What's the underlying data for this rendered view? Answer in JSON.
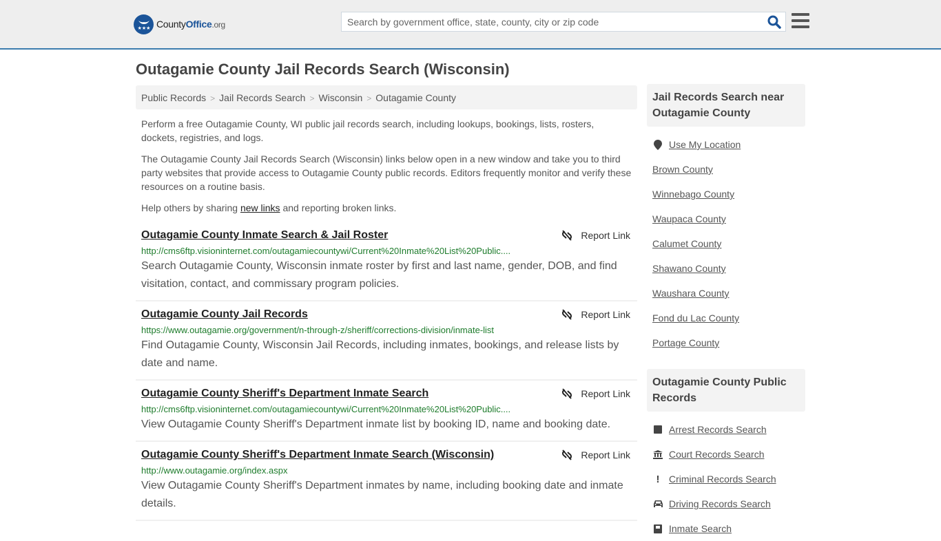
{
  "header": {
    "logo": {
      "brand_prefix": "County",
      "brand_highlight": "Office",
      "brand_suffix": ".org"
    },
    "search": {
      "placeholder": "Search by government office, state, county, city or zip code",
      "value": ""
    },
    "search_icon": "search-icon",
    "menu_icon": "hamburger-menu-icon",
    "colors": {
      "accent": "#3b7cad",
      "brand": "#1b5499"
    }
  },
  "page": {
    "title": "Outagamie County Jail Records Search (Wisconsin)"
  },
  "breadcrumb": [
    "Public Records",
    "Jail Records Search",
    "Wisconsin",
    "Outagamie County"
  ],
  "intro": {
    "p1": "Perform a free Outagamie County, WI public jail records search, including lookups, bookings, lists, rosters, dockets, registries, and logs.",
    "p2": "The Outagamie County Jail Records Search (Wisconsin) links below open in a new window and take you to third party websites that provide access to Outagamie County public records. Editors frequently monitor and verify these resources on a routine basis.",
    "p3_before": "Help others by sharing ",
    "p3_link": "new links",
    "p3_after": " and reporting broken links."
  },
  "results": [
    {
      "title": "Outagamie County Inmate Search & Jail Roster",
      "url": "http://cms6ftp.visioninternet.com/outagamiecountywi/Current%20Inmate%20List%20Public....",
      "description": "Search Outagamie County, Wisconsin inmate roster by first and last name, gender, DOB, and find visitation, contact, and commissary program policies.",
      "report_label": "Report Link"
    },
    {
      "title": "Outagamie County Jail Records",
      "url": "https://www.outagamie.org/government/n-through-z/sheriff/corrections-division/inmate-list",
      "description": "Find Outagamie County, Wisconsin Jail Records, including inmates, bookings, and release lists by date and name.",
      "report_label": "Report Link"
    },
    {
      "title": "Outagamie County Sheriff's Department Inmate Search",
      "url": "http://cms6ftp.visioninternet.com/outagamiecountywi/Current%20Inmate%20List%20Public....",
      "description": "View Outagamie County Sheriff's Department inmate list by booking ID, name and booking date.",
      "report_label": "Report Link"
    },
    {
      "title": "Outagamie County Sheriff's Department Inmate Search (Wisconsin)",
      "url": "http://www.outagamie.org/index.aspx",
      "description": "View Outagamie County Sheriff's Department inmates by name, including booking date and inmate details.",
      "report_label": "Report Link"
    }
  ],
  "sidebar": {
    "nearby": {
      "heading": "Jail Records Search near Outagamie County",
      "use_location": "Use My Location",
      "counties": [
        "Brown County",
        "Winnebago County",
        "Waupaca County",
        "Calumet County",
        "Shawano County",
        "Waushara County",
        "Fond du Lac County",
        "Portage County"
      ]
    },
    "public_records": {
      "heading": "Outagamie County Public Records",
      "items": [
        {
          "label": "Arrest Records Search",
          "icon": "square-icon"
        },
        {
          "label": "Court Records Search",
          "icon": "courthouse-icon"
        },
        {
          "label": "Criminal Records Search",
          "icon": "exclamation-icon"
        },
        {
          "label": "Driving Records Search",
          "icon": "car-icon"
        },
        {
          "label": "Inmate Search",
          "icon": "id-card-icon"
        }
      ]
    }
  }
}
